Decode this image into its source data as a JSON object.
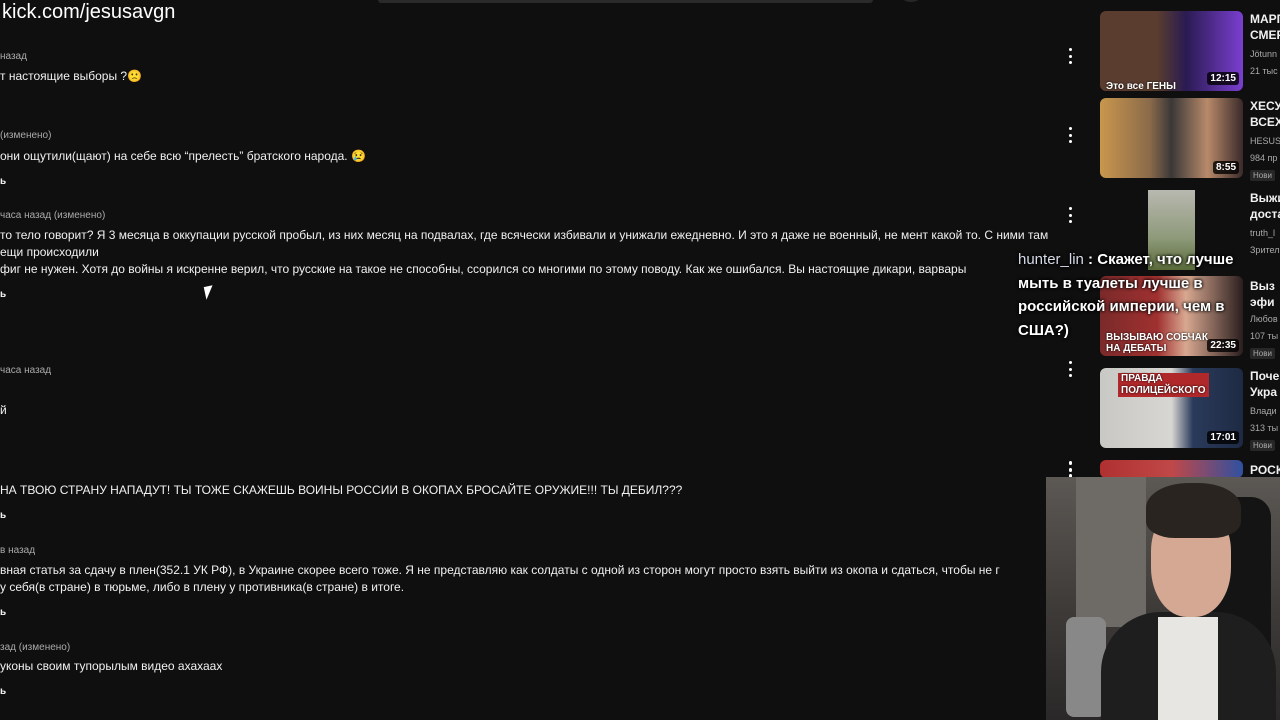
{
  "stream_overlay": {
    "url": "kick.com/jesusavgn"
  },
  "comments": [
    {
      "meta": "назад",
      "text": "т настоящие выборы ?🙁"
    },
    {
      "meta": "(изменено)",
      "text": "они ощутили(щают) на себе всю “прелесть” братского народа. 😢",
      "reply": "ь"
    },
    {
      "meta": "часа назад (изменено)",
      "text": "то тело говорит? Я 3 месяца в оккупации русской пробыл, из них месяц на подвалах, где всячески избивали и унижали ежедневно. И это я даже не военный, не мент какой то. С ними там\nещи происходили\nфиг не нужен. Хотя до войны я искренне верил, что русские на такое не способны, ссорился со многими по этому поводу. Как же ошибался. Вы настоящие дикари, варвары",
      "reply": "ь"
    },
    {
      "meta": "часа назад",
      "text": "й"
    },
    {
      "meta": "",
      "text": "НА ТВОЮ СТРАНУ НАПАДУТ! ТЫ ТОЖЕ СКАЖЕШЬ ВОИНЫ РОССИИ В ОКОПАХ БРОСАЙТЕ ОРУЖИЕ!!! ТЫ ДЕБИЛ???",
      "reply": "ь"
    },
    {
      "meta": "в назад",
      "text": "вная статья за сдачу в плен(352.1 УК РФ), в Украине скорее всего тоже. Я не представляю как солдаты с одной из сторон могут просто взять выйти из окопа и сдаться, чтобы не г\nу себя(в стране) в тюрьме, либо в плену у противника(в стране) в итоге.",
      "reply": "ь"
    },
    {
      "meta": "зад (изменено)",
      "text": "уконы своим тупорылым видео ахахаах",
      "reply": "ь"
    }
  ],
  "sidebar": [
    {
      "title": "МАРГ\nСМЕР",
      "channel": "Jötunn",
      "views": "21 тыс",
      "duration": "12:15",
      "caption": "Это все ГЕНЫ",
      "accent": "#7a3fd0"
    },
    {
      "title": "ХЕСУ\nВСЕХ",
      "channel": "HESUS",
      "views": "984 пр",
      "duration": "8:55",
      "badge": "Нови",
      "accent": "#c9974d"
    },
    {
      "title": "Выжи\nдоста",
      "channel": "truth_l",
      "views": "Зрител",
      "accent": "#8e9a7a"
    },
    {
      "title": "Выз\nэфи",
      "channel": "Любов",
      "views": "107 ты",
      "duration": "22:35",
      "caption": "ВЫЗЫВАЮ СОБЧАК\nНА ДЕБАТЫ",
      "badge": "Нови",
      "accent": "#a03030"
    },
    {
      "title": "Поче\nУкра",
      "channel": "Влади",
      "views": "313 ты",
      "duration": "17:01",
      "caption": "ПРАВДА\nПОЛИЦЕЙСКОГО",
      "badge": "Нови",
      "accent": "#b0282a"
    },
    {
      "title": "РОСК",
      "accent": "#b03030"
    }
  ],
  "chat_message": {
    "user": "hunter_lin",
    "separator": " : ",
    "text": "Скажет, что лучше мыть в туалеты лучше в российской империи, чем в США?)"
  }
}
